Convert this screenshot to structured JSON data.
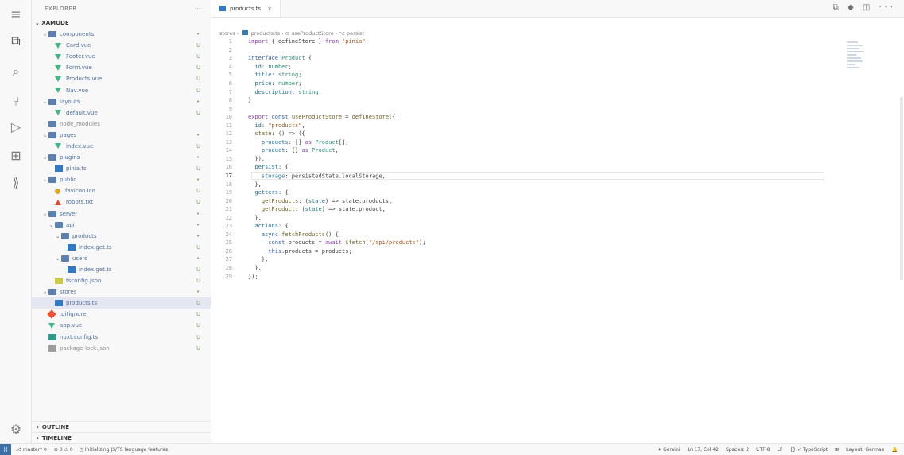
{
  "explorer": {
    "title": "EXPLORER",
    "more": "···",
    "project": "⌄ XAMODE",
    "outline": "OUTLINE",
    "timeline": "TIMELINE"
  },
  "tree": [
    {
      "chev": "⌄",
      "icon": "folder",
      "name": "components",
      "status": "•",
      "indent": 1
    },
    {
      "chev": "",
      "icon": "vue",
      "name": "Card.vue",
      "status": "U",
      "indent": 2
    },
    {
      "chev": "",
      "icon": "vue",
      "name": "Footer.vue",
      "status": "U",
      "indent": 2
    },
    {
      "chev": "",
      "icon": "vue",
      "name": "Form.vue",
      "status": "U",
      "indent": 2
    },
    {
      "chev": "",
      "icon": "vue",
      "name": "Products.vue",
      "status": "U",
      "indent": 2
    },
    {
      "chev": "",
      "icon": "vue",
      "name": "Nav.vue",
      "status": "U",
      "indent": 2
    },
    {
      "chev": "⌄",
      "icon": "folder",
      "name": "layouts",
      "status": "•",
      "indent": 1
    },
    {
      "chev": "",
      "icon": "vue",
      "name": "default.vue",
      "status": "U",
      "indent": 2
    },
    {
      "chev": "›",
      "icon": "folder",
      "name": "node_modules",
      "status": "",
      "indent": 1,
      "muted": true
    },
    {
      "chev": "⌄",
      "icon": "folder",
      "name": "pages",
      "status": "•",
      "indent": 1
    },
    {
      "chev": "",
      "icon": "vue",
      "name": "index.vue",
      "status": "U",
      "indent": 2
    },
    {
      "chev": "⌄",
      "icon": "folder",
      "name": "plugins",
      "status": "•",
      "indent": 1
    },
    {
      "chev": "",
      "icon": "ts",
      "name": "pinia.ts",
      "status": "U",
      "indent": 2
    },
    {
      "chev": "⌄",
      "icon": "folder",
      "name": "public",
      "status": "•",
      "indent": 1
    },
    {
      "chev": "",
      "icon": "svg",
      "name": "favicon.ico",
      "status": "U",
      "indent": 2
    },
    {
      "chev": "",
      "icon": "ico-file",
      "name": "robots.txt",
      "status": "U",
      "indent": 2
    },
    {
      "chev": "⌄",
      "icon": "folder",
      "name": "server",
      "status": "•",
      "indent": 1
    },
    {
      "chev": "⌄",
      "icon": "folder",
      "name": "api",
      "status": "•",
      "indent": 2
    },
    {
      "chev": "⌄",
      "icon": "folder",
      "name": "products",
      "status": "•",
      "indent": 3
    },
    {
      "chev": "",
      "icon": "ts",
      "name": "index.get.ts",
      "status": "U",
      "indent": 4
    },
    {
      "chev": "⌄",
      "icon": "folder",
      "name": "users",
      "status": "•",
      "indent": 3
    },
    {
      "chev": "",
      "icon": "ts",
      "name": "index.get.ts",
      "status": "U",
      "indent": 4
    },
    {
      "chev": "",
      "icon": "json",
      "name": "tsconfig.json",
      "status": "U",
      "indent": 2
    },
    {
      "chev": "⌄",
      "icon": "folder",
      "name": "stores",
      "status": "•",
      "indent": 1
    },
    {
      "chev": "",
      "icon": "ts",
      "name": "products.ts",
      "status": "U",
      "indent": 2,
      "selected": true
    },
    {
      "chev": "",
      "icon": "git",
      "name": ".gitignore",
      "status": "U",
      "indent": 1
    },
    {
      "chev": "",
      "icon": "vue",
      "name": "app.vue",
      "status": "U",
      "indent": 1
    },
    {
      "chev": "",
      "icon": "cfg",
      "name": "nuxt.config.ts",
      "status": "U",
      "indent": 1
    },
    {
      "chev": "",
      "icon": "gray",
      "name": "package-lock.json",
      "status": "U",
      "indent": 1,
      "muted": true
    }
  ],
  "tab": {
    "label": "products.ts",
    "close": "×",
    "actions": "⧉ ◆ ◫ ···"
  },
  "breadcrumb": {
    "part1": "stores ›",
    "part2": "products.ts › ⊙ useProductStore › ⌥ persist"
  },
  "code": [
    {
      "n": "1",
      "html": "<span class='kw'>import</span> { defineStore } <span class='kw'>from</span> <span class='str'>\"pinia\"</span>;"
    },
    {
      "n": "2",
      "html": ""
    },
    {
      "n": "3",
      "html": "<span class='kw2'>interface</span> <span class='type'>Product</span> {"
    },
    {
      "n": "4",
      "html": "  <span class='prop'>id</span>: <span class='type'>number</span>;"
    },
    {
      "n": "5",
      "html": "  <span class='prop'>title</span>: <span class='type'>string</span>;"
    },
    {
      "n": "6",
      "html": "  <span class='prop'>price</span>: <span class='type'>number</span>;"
    },
    {
      "n": "7",
      "html": "  <span class='prop'>description</span>: <span class='type'>string</span>;"
    },
    {
      "n": "8",
      "html": "}"
    },
    {
      "n": "9",
      "html": ""
    },
    {
      "n": "10",
      "html": "<span class='kw'>export</span> <span class='kw2'>const</span> <span class='fn'>useProductStore</span> = <span class='fn'>defineStore</span>({"
    },
    {
      "n": "11",
      "html": "  <span class='prop'>id</span>: <span class='str'>\"products\"</span>,"
    },
    {
      "n": "12",
      "html": "  <span class='fn'>state</span>: () => ({"
    },
    {
      "n": "13",
      "html": "    <span class='prop'>products</span>: [] <span class='kw'>as</span> <span class='type'>Product</span>[],"
    },
    {
      "n": "14",
      "html": "    <span class='prop'>product</span>: {} <span class='kw'>as</span> <span class='type'>Product</span>,"
    },
    {
      "n": "15",
      "html": "  }),"
    },
    {
      "n": "16",
      "html": "  <span class='prop'>persist</span>: {"
    },
    {
      "n": "17",
      "html": "    <span class='prop'>storage</span>: persistedState.localStorage,<span class='cursor'></span>",
      "current": true
    },
    {
      "n": "18",
      "html": "  },"
    },
    {
      "n": "19",
      "html": "  <span class='prop'>getters</span>: {"
    },
    {
      "n": "20",
      "html": "    <span class='fn'>getProducts</span>: (<span class='prop'>state</span>) => state.products,"
    },
    {
      "n": "21",
      "html": "    <span class='fn'>getProduct</span>: (<span class='prop'>state</span>) => state.product,"
    },
    {
      "n": "22",
      "html": "  },"
    },
    {
      "n": "23",
      "html": "  <span class='prop'>actions</span>: {"
    },
    {
      "n": "24",
      "html": "    <span class='kw2'>async</span> <span class='fn'>fetchProducts</span>() {"
    },
    {
      "n": "25",
      "html": "      <span class='kw2'>const</span> products = <span class='kw'>await</span> <span class='fn'>$fetch</span>(<span class='str'>\"/api/products\"</span>);"
    },
    {
      "n": "26",
      "html": "      <span class='kw2'>this</span>.products = products;"
    },
    {
      "n": "27",
      "html": "    },"
    },
    {
      "n": "28",
      "html": "  },"
    },
    {
      "n": "29",
      "html": "});"
    }
  ],
  "statusbar": {
    "remote": "⟩⟨",
    "branch": "⎇ master* ⟳",
    "problems": "⊗ 0 ⚠ 0",
    "initializing": "◷ Initializing JS/TS language features",
    "right": [
      "✦ Gemini",
      "Ln 17, Col 42",
      "Spaces: 2",
      "UTF-8",
      "LF",
      "{} ✓ TypeScript",
      "⊞",
      "Layout: German",
      "🔔"
    ]
  }
}
